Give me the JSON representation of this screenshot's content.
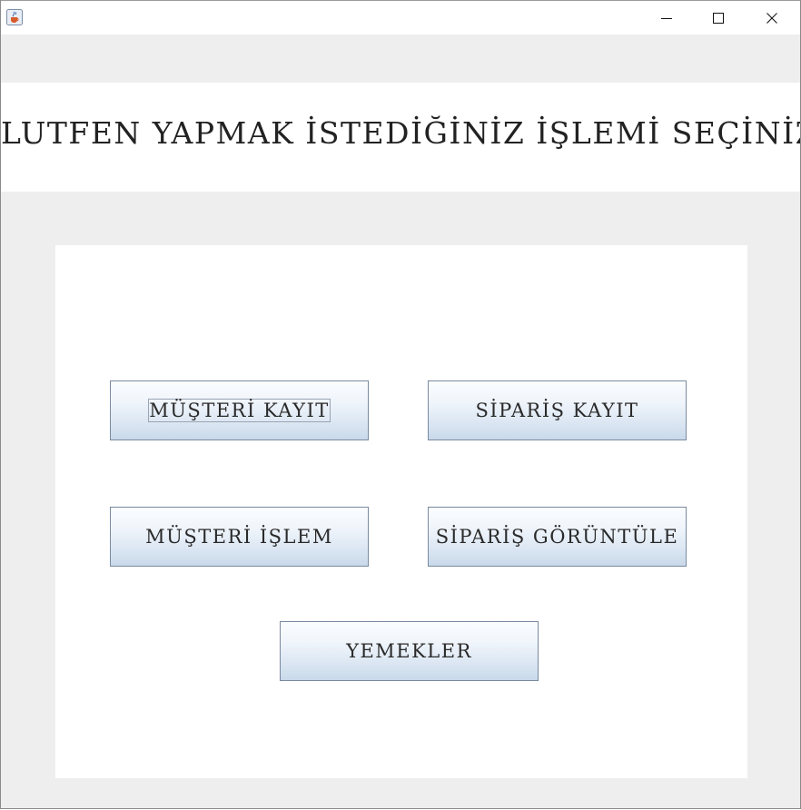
{
  "window": {
    "title": "",
    "icon": "java-cup-icon",
    "controls": {
      "minimize_icon": "minimize-icon",
      "maximize_icon": "maximize-icon",
      "close_icon": "close-icon"
    }
  },
  "header": {
    "title": "LUTFEN YAPMAK İSTEDİĞİNİZ İŞLEMİ SEÇİNİZ"
  },
  "menu": {
    "buttons": [
      {
        "label": "MÜŞTERİ KAYIT",
        "focused": true
      },
      {
        "label": "SİPARİŞ KAYIT",
        "focused": false
      },
      {
        "label": "MÜŞTERİ İŞLEM",
        "focused": false
      },
      {
        "label": "SİPARİŞ GÖRÜNTÜLE",
        "focused": false
      },
      {
        "label": "YEMEKLER",
        "focused": false
      }
    ]
  },
  "colors": {
    "background": "#eeeeee",
    "panel": "#ffffff",
    "button_top": "#fbfdff",
    "button_bottom": "#c9d9ea",
    "button_border": "#7a8aa0",
    "text": "#222222"
  }
}
